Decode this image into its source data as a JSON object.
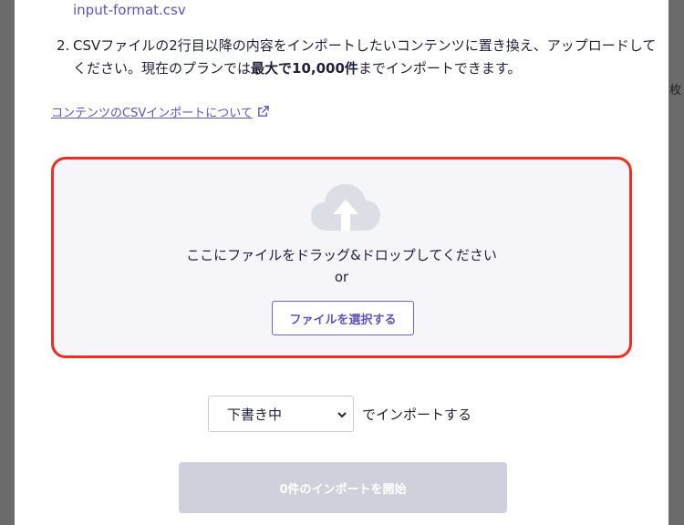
{
  "background": {
    "edge_text": "枚"
  },
  "modal": {
    "filename": "input-format.csv",
    "step2": {
      "number": "2.",
      "text_before": "CSVファイルの2行目以降の内容をインポートしたいコンテンツに置き換え、アップロードしてください。現在のプランでは",
      "text_bold": "最大で10,000件",
      "text_after": "までインポートできます。"
    },
    "help_link": {
      "label": "コンテンツのCSVインポートについて",
      "icon": "external-link-icon"
    },
    "dropzone": {
      "icon": "cloud-upload-icon",
      "instruction": "ここにファイルをドラッグ&ドロップしてください",
      "or": "or",
      "select_button": "ファイルを選択する",
      "border_color": "#ef2d22"
    },
    "status_select": {
      "value": "下書き中",
      "suffix": "でインポートする"
    },
    "start_button": {
      "label": "0件のインポートを開始",
      "disabled": true
    }
  },
  "colors": {
    "accent": "#5b55b8",
    "text": "#21213b",
    "disabled_button": "#cfd0dc"
  }
}
